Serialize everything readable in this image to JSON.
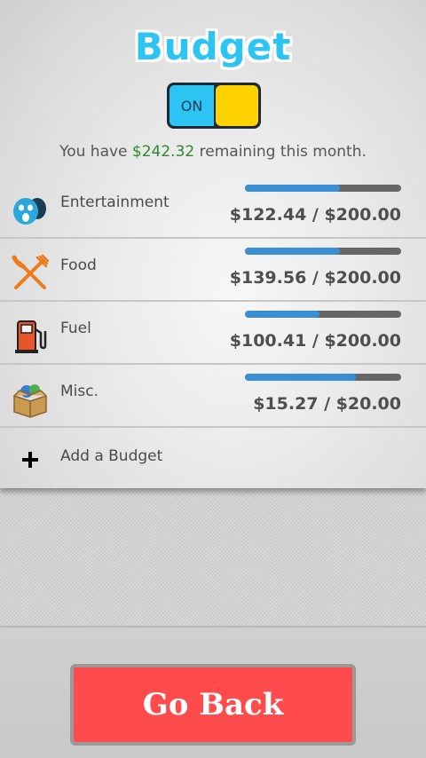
{
  "header": {
    "title": "Budget",
    "toggle_label": "ON"
  },
  "summary": {
    "prefix": "You have ",
    "amount": "$242.32",
    "suffix": " remaining this month."
  },
  "budgets": [
    {
      "label": "Entertainment",
      "amount_text": "$122.44 / $200.00",
      "progress": 0.61,
      "icon": "masks-icon"
    },
    {
      "label": "Food",
      "amount_text": "$139.56 / $200.00",
      "progress": 0.61,
      "icon": "fork-knife-icon"
    },
    {
      "label": "Fuel",
      "amount_text": "$100.41 / $200.00",
      "progress": 0.48,
      "icon": "fuel-pump-icon"
    },
    {
      "label": "Misc.",
      "amount_text": "$15.27 / $20.00",
      "progress": 0.71,
      "icon": "box-icon"
    }
  ],
  "add_budget": {
    "label": "Add a Budget",
    "icon": "plus-icon"
  },
  "footer": {
    "go_back_label": "Go Back"
  },
  "colors": {
    "title": "#2bc4f3",
    "toggle_on": "#2bc4f3",
    "toggle_knob": "#ffd200",
    "remaining_amount": "#2a8a2a",
    "progress_fill": "#3a8fd4",
    "progress_track": "#666666",
    "go_back_button": "#ff4b4b"
  }
}
